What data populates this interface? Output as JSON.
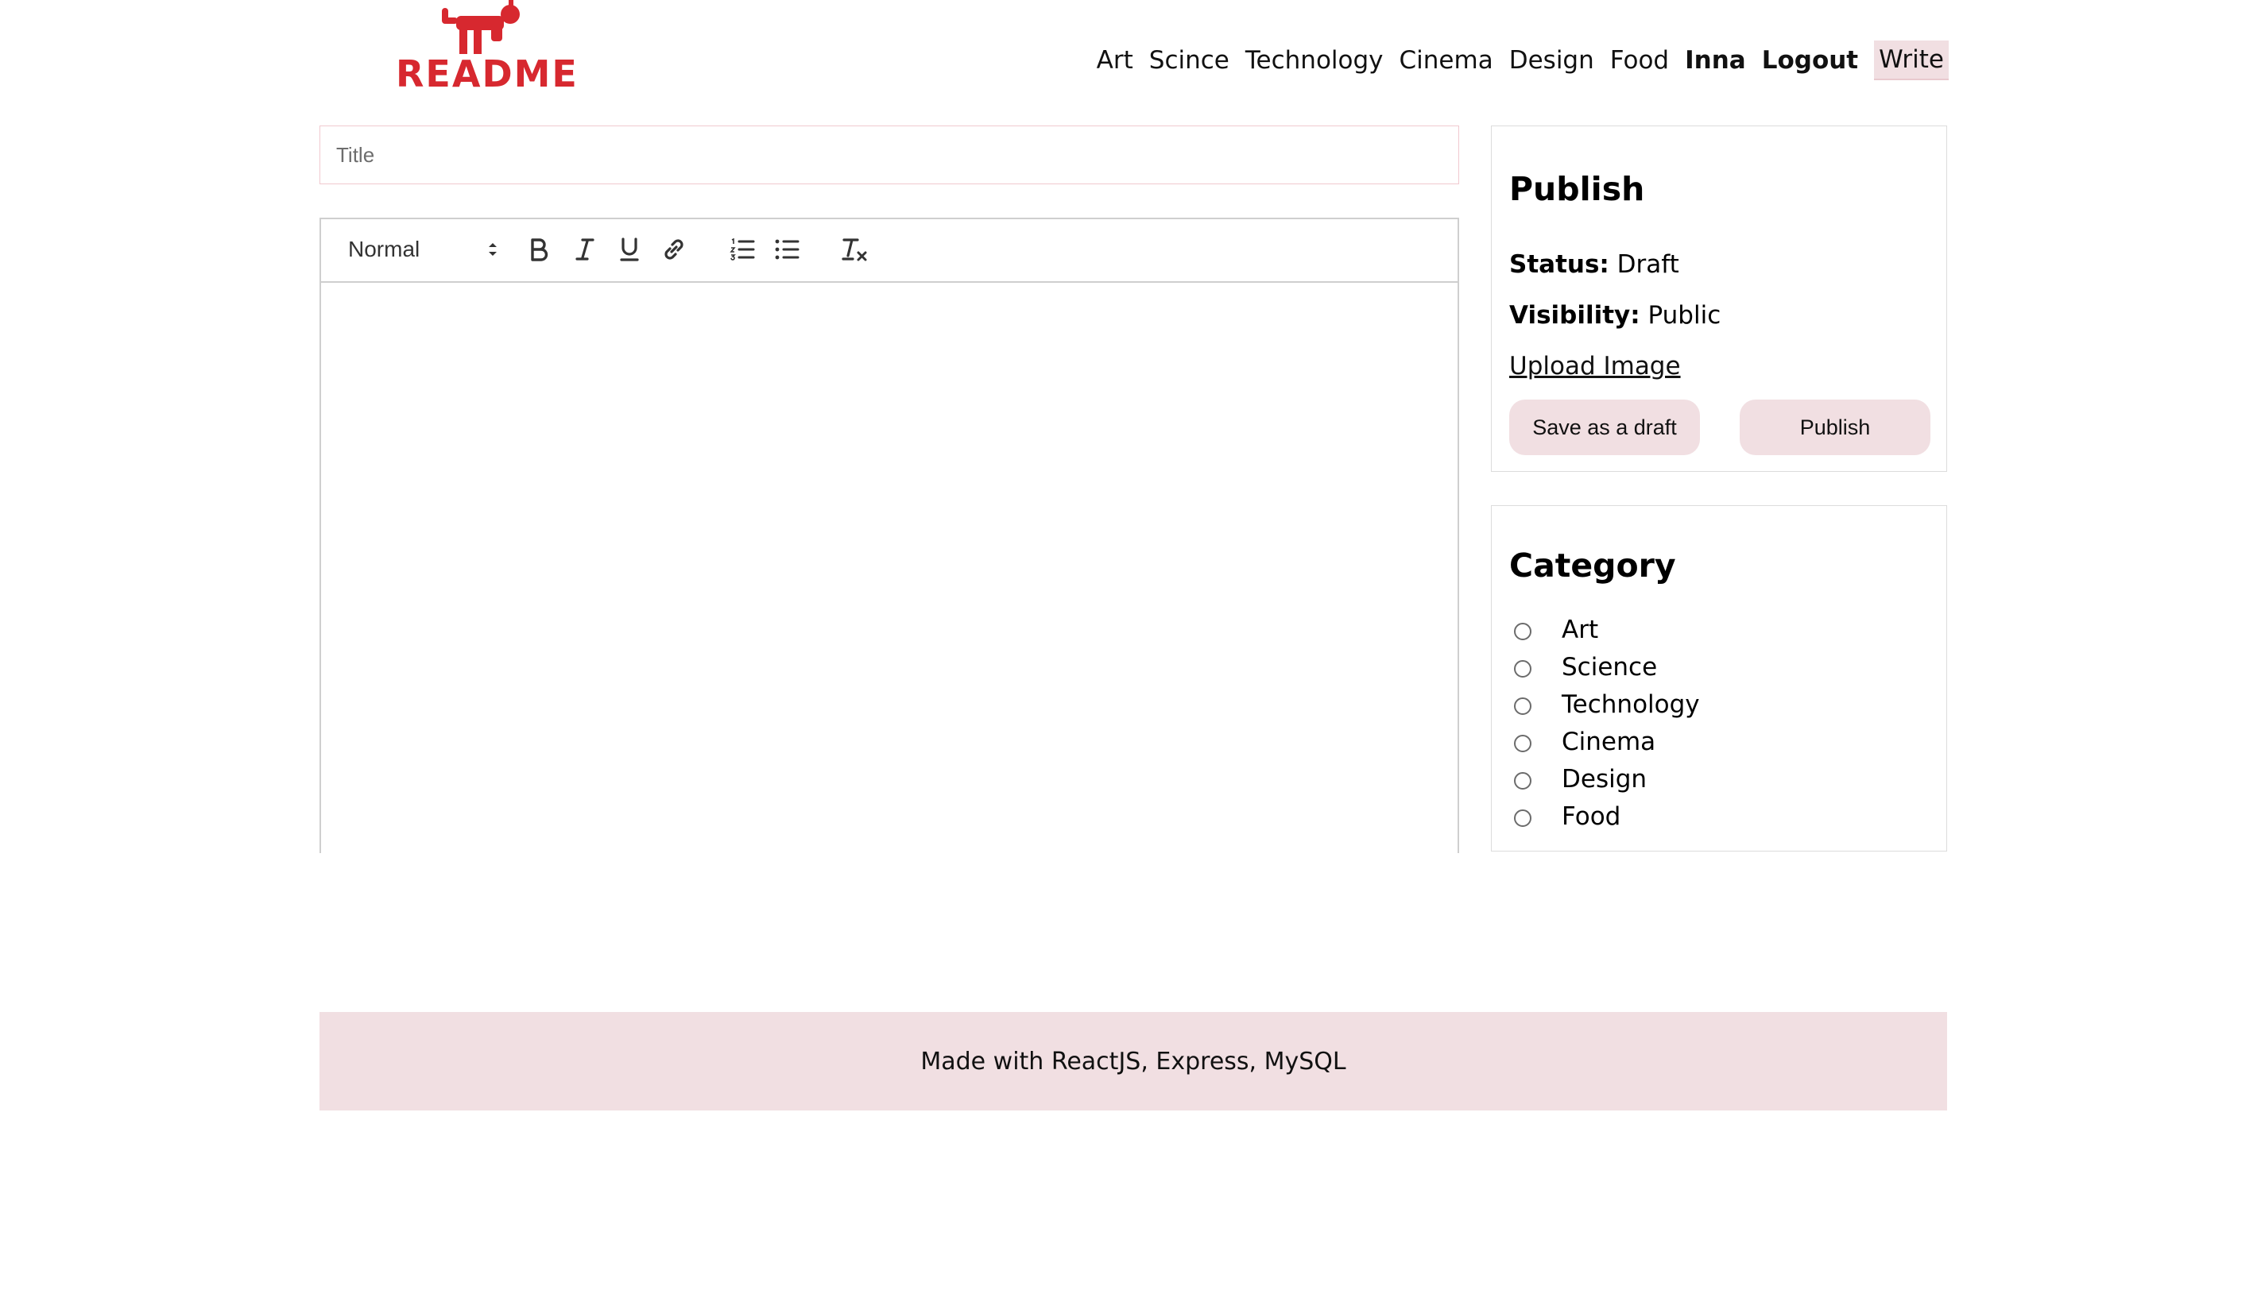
{
  "brand": {
    "name": "README",
    "logo_icon": "monkey-logo-icon",
    "color": "#d7282f"
  },
  "nav": {
    "links": [
      "Art",
      "Scince",
      "Technology",
      "Cinema",
      "Design",
      "Food"
    ],
    "user": "Inna",
    "logout": "Logout",
    "write": "Write"
  },
  "editor": {
    "title_placeholder": "Title",
    "format_value": "Normal",
    "toolbar_icons": [
      "bold-icon",
      "italic-icon",
      "underline-icon",
      "link-icon",
      "ordered-list-icon",
      "bullet-list-icon",
      "clear-format-icon"
    ]
  },
  "publish": {
    "heading": "Publish",
    "status_label": "Status:",
    "status_value": "Draft",
    "visibility_label": "Visibility:",
    "visibility_value": "Public",
    "upload_label": "Upload Image",
    "draft_button": "Save as a draft",
    "publish_button": "Publish"
  },
  "category": {
    "heading": "Category",
    "items": [
      "Art",
      "Science",
      "Technology",
      "Cinema",
      "Design",
      "Food"
    ]
  },
  "footer": {
    "text": "Made with ReactJS, Express, MySQL"
  },
  "colors": {
    "accent_pink": "#f1dfe2",
    "brand_red": "#d7282f"
  }
}
